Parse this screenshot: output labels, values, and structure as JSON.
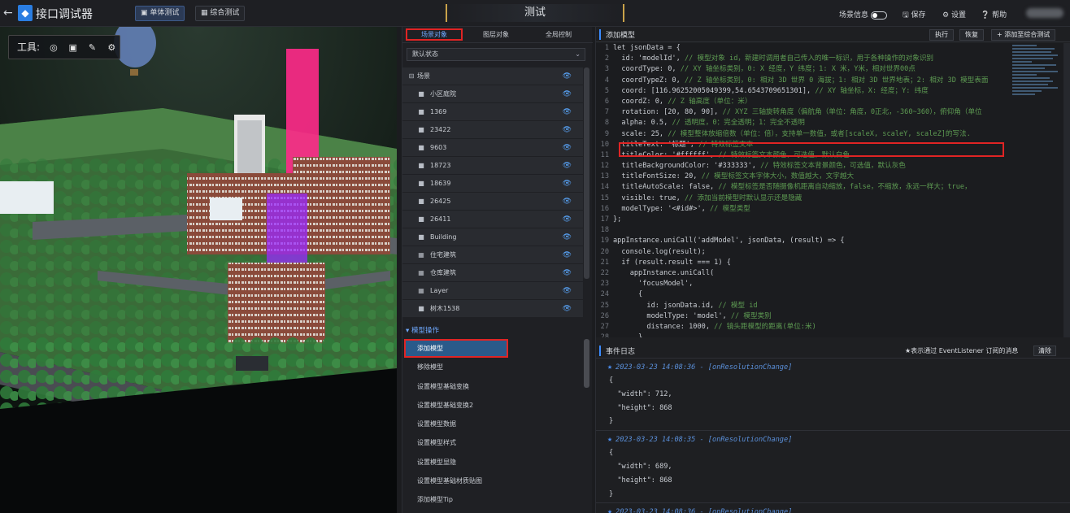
{
  "app": {
    "title": "接口调试器",
    "back_icon": "arrow-left-icon"
  },
  "topbar": {
    "tab_unit": "单体测试",
    "tab_composite": "综合测试",
    "center_title": "测试",
    "scene_info": "场景信息",
    "save": "保存",
    "settings": "设置",
    "help": "帮助"
  },
  "scene": {
    "tools_label": "工具:"
  },
  "left_panel": {
    "tabs": [
      "场景对象",
      "图层对象",
      "全局控制"
    ],
    "state_select": "默认状态",
    "tree_root": "场景",
    "tree_items": [
      "小区庭院",
      "1369",
      "23422",
      "9603",
      "18723",
      "18639",
      "26425",
      "26411",
      "Building",
      "住宅建筑",
      "仓库建筑",
      "Layer",
      "树木1538"
    ],
    "section": "模型操作",
    "menu": [
      "添加模型",
      "移除模型",
      "设置模型基础变换",
      "设置模型基础变换2",
      "设置模型数据",
      "设置模型样式",
      "设置模型显隐",
      "设置模型基础材质贴图",
      "添加模型Tip"
    ]
  },
  "editor": {
    "title": "添加模型",
    "run": "执行",
    "restore": "恢复",
    "add_composite": "添加至综合测试",
    "line_numbers": [
      "1",
      "2",
      "3",
      "4",
      "5",
      "6",
      "7",
      "8",
      "9",
      "10",
      "11",
      "12",
      "13",
      "14",
      "15",
      "16",
      "17",
      "18",
      "19",
      "20",
      "21",
      "22",
      "23",
      "24",
      "25",
      "26",
      "27",
      "28"
    ],
    "lines": [
      {
        "a": "let jsonData = {",
        "b": ""
      },
      {
        "a": "  id: 'modelId',",
        "b": " // 模型对象 id，新建时调用者自己传入的唯一标识，用于各种操作的对象识别"
      },
      {
        "a": "  coordType: 0,",
        "b": " // XY 轴坐标类别，0: X 经度，Y 纬度；1: X 米，Y米，相对世界00点"
      },
      {
        "a": "  coordTypeZ: 0,",
        "b": " // Z 轴坐标类别，0: 相对 3D 世界 0 海拔；1: 相对 3D 世界地表；2: 相对 3D 模型表面"
      },
      {
        "a": "  coord: [116.96252005049399,54.6543709651301],",
        "b": " // XY 轴坐标，X: 经度；Y: 纬度"
      },
      {
        "a": "  coordZ: 0,",
        "b": " // Z 轴高度（单位：米）"
      },
      {
        "a": "  rotation: [20, 80, 90],",
        "b": " // XYZ 三轴旋转角度（偏航角（单位：角度，0正北，-360~360），俯仰角（单位"
      },
      {
        "a": "  alpha: 0.5,",
        "b": " // 透明度，0：完全透明；1：完全不透明"
      },
      {
        "a": "  scale: 25,",
        "b": " // 模型整体放缩倍数（单位：倍），支持单一数值，或者[scaleX, scaleY, scaleZ]的写法."
      },
      {
        "a": "  titleText: '标题',",
        "b": " // 特效标签文本"
      },
      {
        "a": "  titleColor: '#ffffff',",
        "b": " // 特效标签文本颜色，可选值，默认白色"
      },
      {
        "a": "  titleBackgroundColor: '#333333',",
        "b": " // 特效标签文本背景颜色，可选值，默认灰色"
      },
      {
        "a": "  titleFontSize: 20,",
        "b": " // 模型标签文本字体大小，数值越大，文字越大"
      },
      {
        "a": "  titleAutoScale: false,",
        "b": " // 模型标签是否随摄像机距离自动缩放，false，不缩放，永远一样大；true，"
      },
      {
        "a": "  visible: true,",
        "b": " // 添加当前模型时默认显示还是隐藏"
      },
      {
        "a": "  modelType: '<#id#>',",
        "b": " // 模型类型"
      },
      {
        "a": "};",
        "b": ""
      },
      {
        "a": "",
        "b": ""
      },
      {
        "a": "appInstance.uniCall('addModel', jsonData, (result) => {",
        "b": ""
      },
      {
        "a": "  console.log(result);",
        "b": ""
      },
      {
        "a": "  if (result.result === 1) {",
        "b": ""
      },
      {
        "a": "    appInstance.uniCall(",
        "b": ""
      },
      {
        "a": "      'focusModel',",
        "b": ""
      },
      {
        "a": "      {",
        "b": ""
      },
      {
        "a": "        id: jsonData.id,",
        "b": " // 模型 id"
      },
      {
        "a": "        modelType: 'model',",
        "b": " // 模型类别"
      },
      {
        "a": "        distance: 1000,",
        "b": " // 镜头距模型的距离(单位:米)"
      },
      {
        "a": "      },",
        "b": ""
      }
    ]
  },
  "events": {
    "title": "事件日志",
    "note": "★表示通过 EventListener 订阅的消息",
    "clear": "清除",
    "entries": [
      {
        "header": "2023-03-23 14:08:36 - [onResolutionChange]",
        "body": [
          "{",
          "  \"width\": 712,",
          "  \"height\": 868",
          "}"
        ]
      },
      {
        "header": "2023-03-23 14:08:35 - [onResolutionChange]",
        "body": [
          "{",
          "  \"width\": 689,",
          "  \"height\": 868",
          "}"
        ]
      },
      {
        "header": "2023-03-23 14:08:36 - [onResolutionChange]",
        "body": []
      }
    ]
  },
  "colors": {
    "accent": "#3a8bff",
    "highlight": "#e02424",
    "eye": "#5aa8ff"
  }
}
